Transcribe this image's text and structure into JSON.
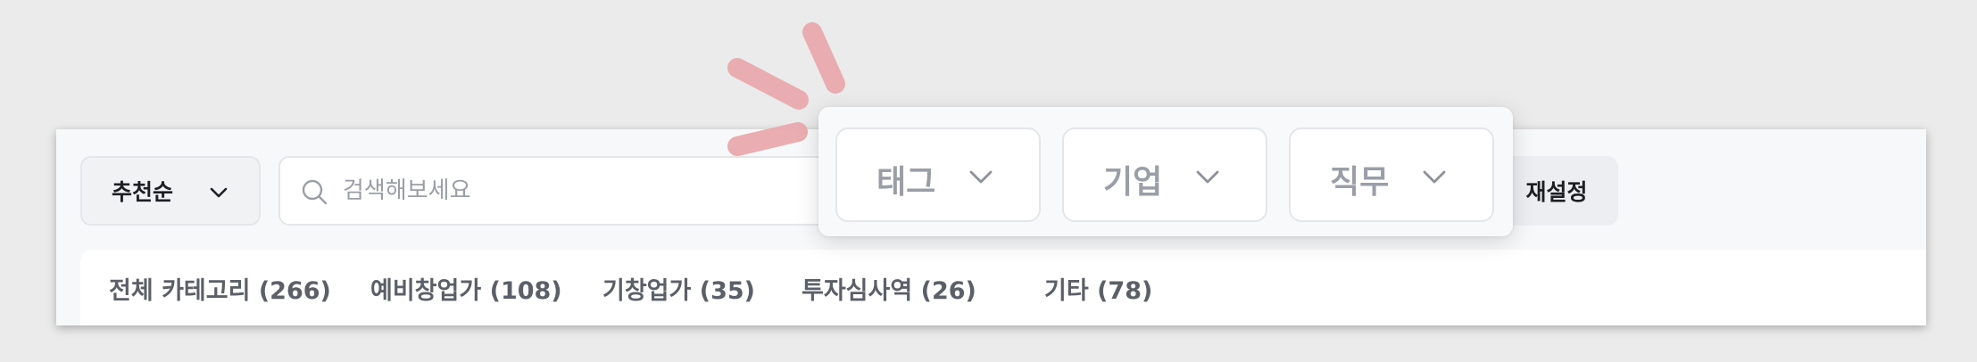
{
  "toolbar": {
    "sort_label": "추천순",
    "search_placeholder": "검색해보세요",
    "reset_label": "재설정"
  },
  "categories": [
    {
      "label": "전체 카테고리 (266)"
    },
    {
      "label": "예비창업가 (108)"
    },
    {
      "label": "기창업가 (35)"
    },
    {
      "label": "투자심사역 (26)"
    },
    {
      "label": "기타 (78)"
    }
  ],
  "filters": [
    {
      "label": "태그"
    },
    {
      "label": "기업"
    },
    {
      "label": "직무"
    }
  ],
  "colors": {
    "background": "#ebebeb",
    "panel": "#f7f8f9",
    "text_dark": "#1d1f24",
    "text_muted": "#9a9ea6",
    "category_text": "#5b6068",
    "accent_marks": "#e9a9ae"
  },
  "icons": {
    "sort_chevron": "chevron-down-icon",
    "search": "search-icon",
    "filter_chevron": "chevron-down-icon",
    "decoration": "pop-emphasis-icon"
  }
}
